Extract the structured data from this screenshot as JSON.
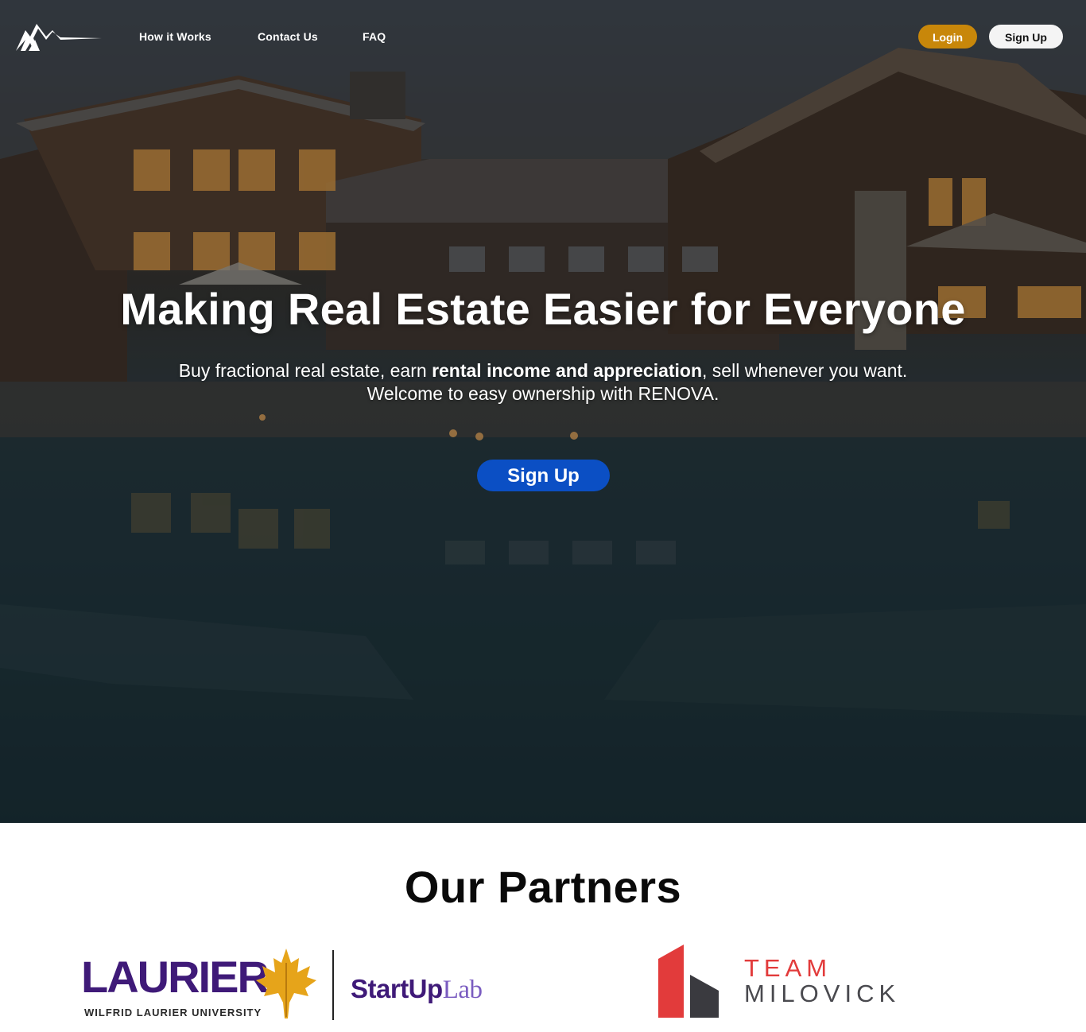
{
  "nav": {
    "links": [
      "How it Works",
      "Contact Us",
      "FAQ"
    ],
    "login_label": "Login",
    "signup_label": "Sign Up"
  },
  "hero": {
    "title": "Making Real Estate Easier for Everyone",
    "subtitle_part1": "Buy fractional real estate, earn ",
    "subtitle_bold": "rental income and appreciation",
    "subtitle_part2": ", sell whenever you want.",
    "subtitle_line2": "Welcome to easy ownership with RENOVA.",
    "cta_label": "Sign Up"
  },
  "partners": {
    "title": "Our Partners",
    "laurier": {
      "wordmark": "LAURIER",
      "university": "WILFRID LAURIER UNIVERSITY",
      "startup_bold": "StartUp",
      "startup_light": "Lab"
    },
    "milovick": {
      "line1": "TEAM",
      "line2": "MILOVICK"
    }
  },
  "colors": {
    "login_button": "#c8870a",
    "cta_button": "#0b4fc4",
    "laurier_purple": "#3f1a78",
    "milovick_red": "#e23b3b",
    "milovick_gray": "#4a4a4f"
  },
  "icons": {
    "logo": "mountain-logo-icon",
    "laurier_leaf": "maple-leaf-icon",
    "milovick_mark": "building-mark-icon"
  }
}
